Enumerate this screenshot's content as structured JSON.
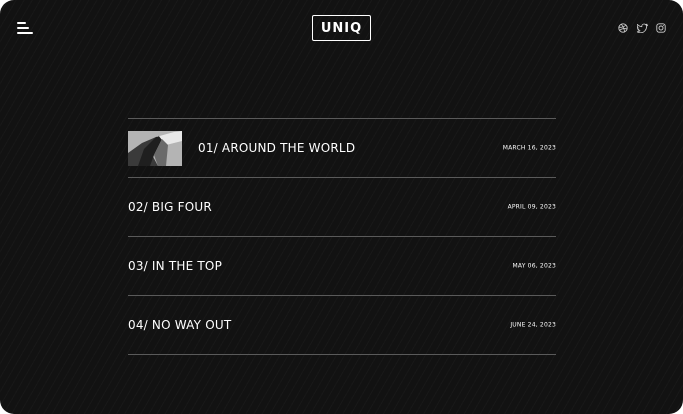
{
  "header": {
    "logo": "UNIQ",
    "menu_icon": "hamburger-menu-icon",
    "social_icons": [
      "dribbble-icon",
      "twitter-icon",
      "instagram-icon"
    ]
  },
  "list": {
    "items": [
      {
        "title": "01/ AROUND THE WORLD",
        "date": "MARCH 16, 2023",
        "has_thumbnail": true
      },
      {
        "title": "02/ BIG FOUR",
        "date": "APRIL 09, 2023",
        "has_thumbnail": false
      },
      {
        "title": "03/ IN THE TOP",
        "date": "MAY 06, 2023",
        "has_thumbnail": false
      },
      {
        "title": "04/ NO WAY OUT",
        "date": "JUNE 24, 2023",
        "has_thumbnail": false
      }
    ]
  },
  "colors": {
    "background": "#121212",
    "text": "#ffffff",
    "divider": "#5a5a5a"
  }
}
